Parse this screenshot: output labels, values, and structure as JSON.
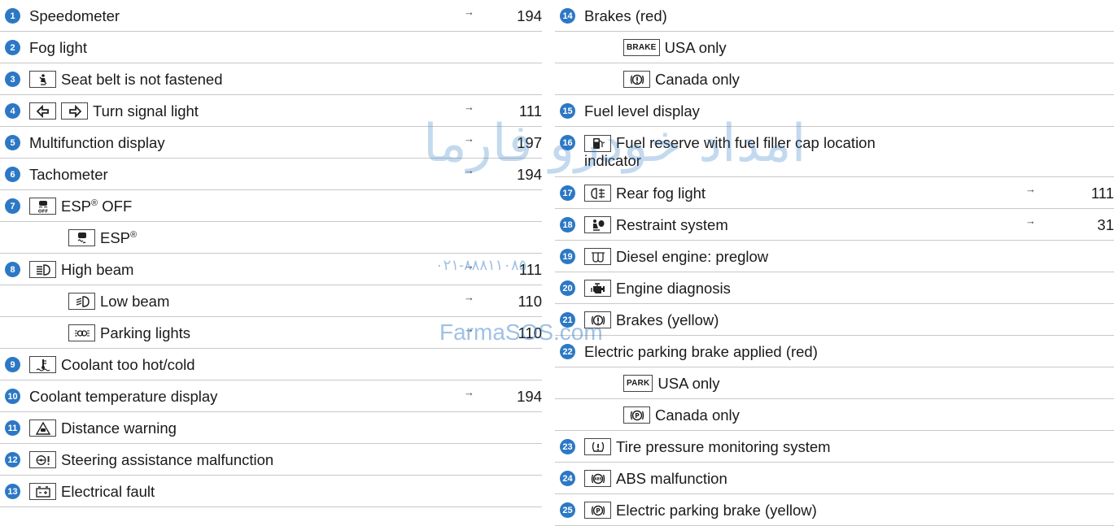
{
  "arrow_glyph": "→",
  "watermark": {
    "fa": "امداد خودرو فارما",
    "tel": "۰۲۱-۸۸۸۱۱۰۸۵",
    "en": "FarmaSOS.com"
  },
  "left": [
    {
      "num": "1",
      "text": "Speedometer",
      "page": "194"
    },
    {
      "num": "2",
      "text": "Fog light"
    },
    {
      "num": "3",
      "icons": [
        "seatbelt-icon"
      ],
      "text": "Seat belt is not fastened"
    },
    {
      "num": "4",
      "icons": [
        "turn-left-icon",
        "turn-right-icon"
      ],
      "text": "Turn signal light",
      "page": "111"
    },
    {
      "num": "5",
      "text": "Multifunction display",
      "page": "197"
    },
    {
      "num": "6",
      "text": "Tachometer",
      "page": "194"
    },
    {
      "num": "7",
      "icons": [
        "esp-off-icon"
      ],
      "text": "ESP® OFF"
    },
    {
      "icons": [
        "esp-icon"
      ],
      "text": "ESP®"
    },
    {
      "num": "8",
      "icons": [
        "high-beam-icon"
      ],
      "text": "High beam",
      "page": "111"
    },
    {
      "icons": [
        "low-beam-icon"
      ],
      "text": "Low beam",
      "page": "110"
    },
    {
      "icons": [
        "parking-lights-icon"
      ],
      "text": "Parking lights",
      "page": "110"
    },
    {
      "num": "9",
      "icons": [
        "coolant-icon"
      ],
      "text": "Coolant too hot/cold"
    },
    {
      "num": "10",
      "text": "Coolant temperature display",
      "page": "194"
    },
    {
      "num": "11",
      "icons": [
        "distance-warning-icon"
      ],
      "text": "Distance warning"
    },
    {
      "num": "12",
      "icons": [
        "steering-malfunction-icon"
      ],
      "text": "Steering assistance malfunction"
    },
    {
      "num": "13",
      "icons": [
        "battery-icon"
      ],
      "text": "Electrical fault"
    }
  ],
  "right": [
    {
      "num": "14",
      "text": "Brakes (red)"
    },
    {
      "icons": [
        "brake-text-icon"
      ],
      "icon_text": "BRAKE",
      "text": "USA only"
    },
    {
      "icons": [
        "brake-circle-icon"
      ],
      "text": "Canada only"
    },
    {
      "num": "15",
      "text": "Fuel level display"
    },
    {
      "num": "16",
      "icons": [
        "fuel-icon"
      ],
      "text": "Fuel reserve with fuel filler cap location indicator",
      "tall": true
    },
    {
      "num": "17",
      "icons": [
        "rear-fog-icon"
      ],
      "text": "Rear fog light",
      "page": "111"
    },
    {
      "num": "18",
      "icons": [
        "restraint-icon"
      ],
      "text": "Restraint system",
      "page": "31"
    },
    {
      "num": "19",
      "icons": [
        "preglow-icon"
      ],
      "text": "Diesel engine: preglow"
    },
    {
      "num": "20",
      "icons": [
        "engine-icon"
      ],
      "text": "Engine diagnosis"
    },
    {
      "num": "21",
      "icons": [
        "brake-circle-icon"
      ],
      "text": "Brakes (yellow)"
    },
    {
      "num": "22",
      "text": "Electric parking brake applied (red)"
    },
    {
      "icons": [
        "park-text-icon"
      ],
      "icon_text": "PARK",
      "text": "USA only"
    },
    {
      "icons": [
        "parking-brake-icon"
      ],
      "text": "Canada only"
    },
    {
      "num": "23",
      "icons": [
        "tire-pressure-icon"
      ],
      "text": "Tire pressure monitoring system"
    },
    {
      "num": "24",
      "icons": [
        "abs-icon"
      ],
      "text": "ABS malfunction"
    },
    {
      "num": "25",
      "icons": [
        "parking-brake-icon"
      ],
      "text": "Electric parking brake (yellow)"
    }
  ]
}
